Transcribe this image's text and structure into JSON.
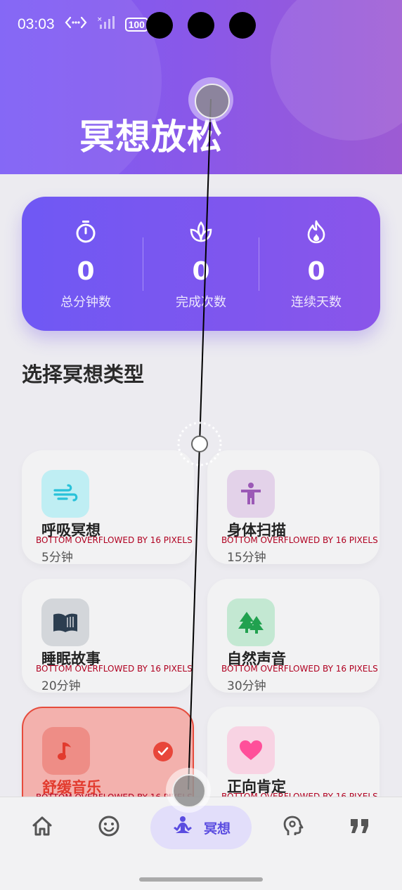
{
  "status": {
    "time": "03:03",
    "battery": "100"
  },
  "header": {
    "title": "冥想放松"
  },
  "stats": [
    {
      "value": "0",
      "label": "总分钟数",
      "icon": "timer-icon"
    },
    {
      "value": "0",
      "label": "完成次数",
      "icon": "spa-icon"
    },
    {
      "value": "0",
      "label": "连续天数",
      "icon": "fire-icon"
    }
  ],
  "section_title": "选择冥想类型",
  "overflow_text": "BOTTOM OVERFLOWED BY 16 PIXELS",
  "cards": [
    {
      "name": "呼吸冥想",
      "duration": "5分钟",
      "icon": "wind-icon",
      "color": "#29c2d9"
    },
    {
      "name": "身体扫描",
      "duration": "15分钟",
      "icon": "body-icon",
      "color": "#9b59b6"
    },
    {
      "name": "睡眠故事",
      "duration": "20分钟",
      "icon": "book-icon",
      "color": "#2c3e50"
    },
    {
      "name": "自然声音",
      "duration": "30分钟",
      "icon": "tree-icon",
      "color": "#21a14f"
    },
    {
      "name": "舒缓音乐",
      "duration": "",
      "icon": "music-note-icon",
      "color": "#e23b2e",
      "selected": true
    },
    {
      "name": "正向肯定",
      "duration": "",
      "icon": "heart-icon",
      "color": "#ff4f9a"
    }
  ],
  "nav": {
    "items": [
      {
        "icon": "home-icon"
      },
      {
        "icon": "smiley-icon"
      },
      {
        "icon": "meditation-icon",
        "label": "冥想",
        "active": true
      },
      {
        "icon": "psychology-icon"
      },
      {
        "icon": "quote-icon"
      }
    ]
  },
  "colors": {
    "accent": "#6f58f4",
    "nav_active": "#5a4ce0",
    "selected_card": "#f3b1ad",
    "overflow": "#b00020"
  }
}
